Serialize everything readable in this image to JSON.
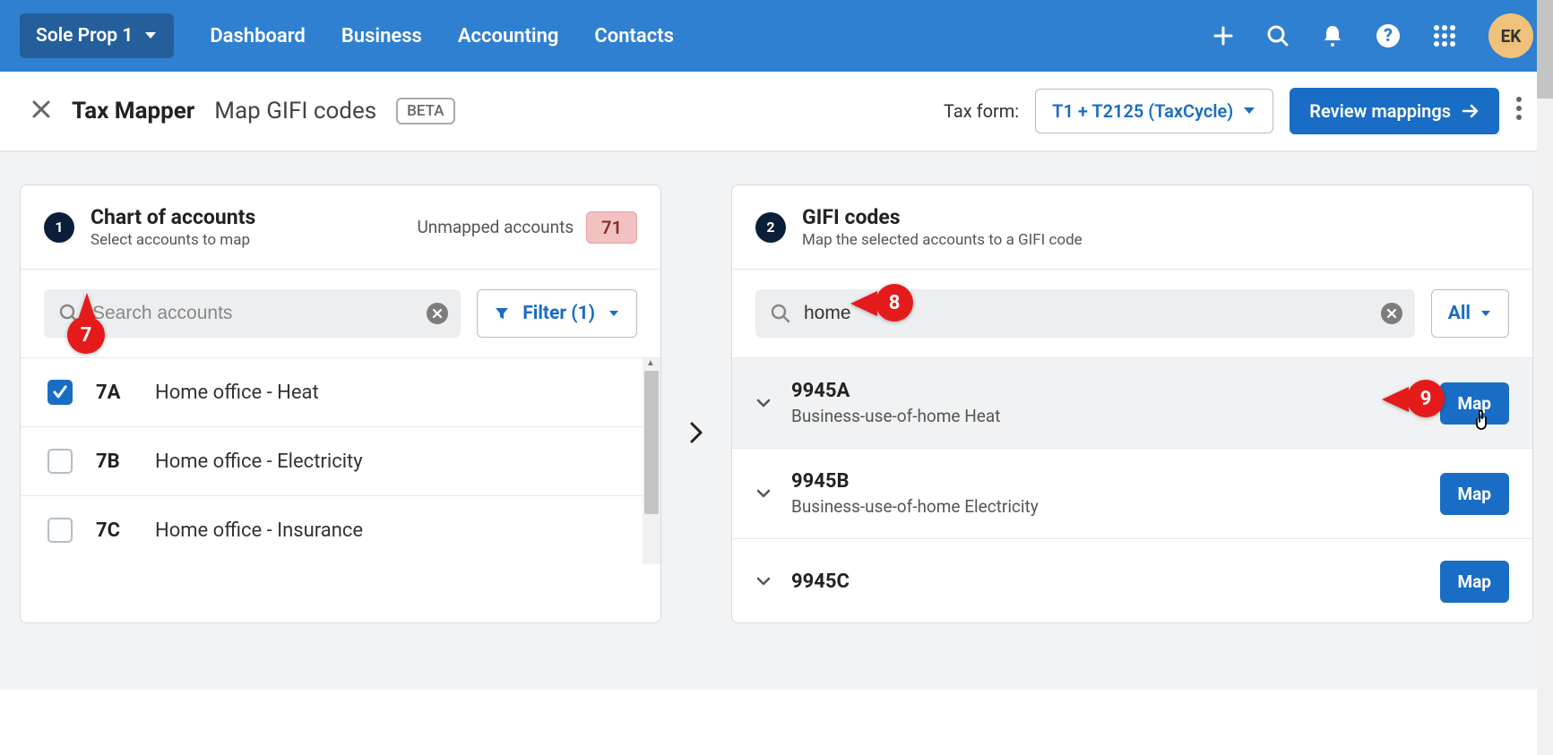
{
  "topbar": {
    "org_name": "Sole Prop 1",
    "nav": [
      "Dashboard",
      "Business",
      "Accounting",
      "Contacts"
    ],
    "avatar_initials": "EK"
  },
  "subbar": {
    "title": "Tax Mapper",
    "subtitle": "Map GIFI codes",
    "badge": "BETA",
    "tax_form_label": "Tax form:",
    "tax_form_value": "T1 + T2125 (TaxCycle)",
    "review_button": "Review mappings"
  },
  "panel_left": {
    "step": "1",
    "title": "Chart of accounts",
    "subtitle": "Select accounts to map",
    "unmapped_label": "Unmapped accounts",
    "unmapped_count": "71",
    "search_placeholder": "Search accounts",
    "search_value": "",
    "filter_label": "Filter (1)",
    "rows": [
      {
        "code": "7A",
        "name": "Home office - Heat",
        "checked": true
      },
      {
        "code": "7B",
        "name": "Home office - Electricity",
        "checked": false
      },
      {
        "code": "7C",
        "name": "Home office - Insurance",
        "checked": false
      }
    ]
  },
  "panel_right": {
    "step": "2",
    "title": "GIFI codes",
    "subtitle": "Map the selected accounts to a GIFI code",
    "search_value": "home",
    "all_label": "All",
    "rows": [
      {
        "code": "9945A",
        "desc": "Business-use-of-home Heat",
        "button": "Map",
        "active": true
      },
      {
        "code": "9945B",
        "desc": "Business-use-of-home Electricity",
        "button": "Map",
        "active": false
      },
      {
        "code": "9945C",
        "desc": "",
        "button": "Map",
        "active": false
      }
    ]
  },
  "callouts": {
    "c7": "7",
    "c8": "8",
    "c9": "9"
  }
}
